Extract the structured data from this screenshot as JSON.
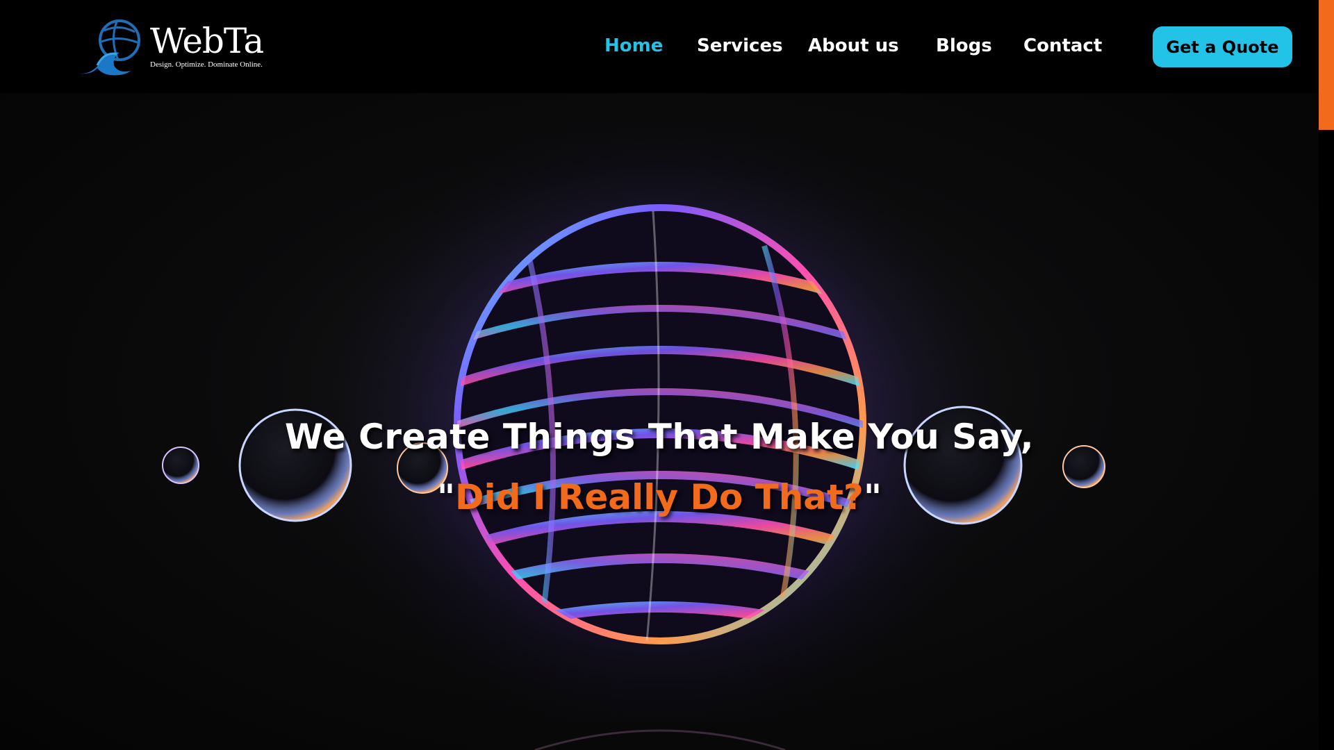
{
  "logo": {
    "name": "WebTa",
    "tagline": "Design. Optimize. Dominate Online."
  },
  "nav": {
    "items": [
      {
        "label": "Home",
        "active": true
      },
      {
        "label": "Services",
        "active": false
      },
      {
        "label": "About us",
        "active": false
      },
      {
        "label": "Blogs",
        "active": false
      },
      {
        "label": "Contact",
        "active": false
      }
    ],
    "cta_label": "Get a Quote"
  },
  "hero": {
    "title": "We Create Things That Make You Say,",
    "subtitle_open_quote": "\"",
    "subtitle_highlight": "Did I Really Do That?",
    "subtitle_close_quote": "\""
  },
  "colors": {
    "accent_cyan": "#22c3e6",
    "accent_orange": "#f26a1b",
    "background": "#000000",
    "text": "#ffffff"
  },
  "icons": {
    "logo_mark": "globe-wave-icon"
  },
  "scroll": {
    "position_fraction": 0.0
  }
}
